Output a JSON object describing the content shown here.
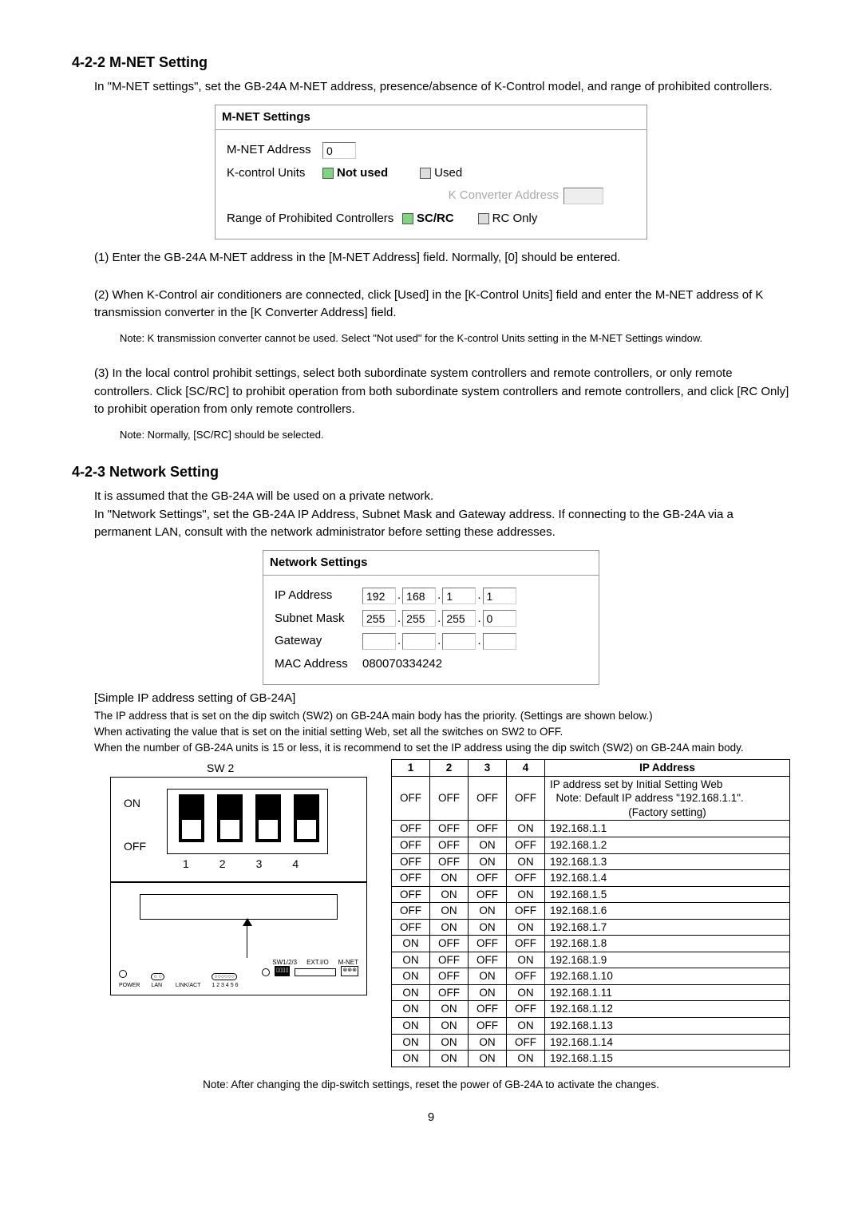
{
  "sec422": {
    "heading": "4-2-2 M-NET Setting",
    "intro": "In \"M-NET settings\", set the GB-24A M-NET address, presence/absence of K-Control model, and range of prohibited controllers.",
    "box": {
      "title": "M-NET Settings",
      "mnet_label": "M-NET Address",
      "mnet_value": "0",
      "kcontrol_label": "K-control Units",
      "notused": "Not used",
      "used": "Used",
      "kconv_label": "K Converter Address",
      "kconv_value": "",
      "range_label": "Range of Prohibited Controllers",
      "scrc": "SC/RC",
      "rconly": "RC Only"
    },
    "p1": "(1) Enter the GB-24A M-NET address in the [M-NET Address] field. Normally, [0] should be entered.",
    "p2": "(2) When K-Control air conditioners are connected, click [Used] in the [K-Control Units] field and enter the M-NET address of K transmission converter in the [K Converter Address] field.",
    "p2note": "Note: K transmission converter cannot be used. Select \"Not used\" for the K-control Units setting in the M-NET Settings window.",
    "p3": "(3) In the local control prohibit settings, select both subordinate system controllers and remote controllers, or only remote controllers. Click [SC/RC] to prohibit operation from both subordinate system controllers and remote controllers, and click [RC Only] to prohibit operation from only remote controllers.",
    "p3note": "Note: Normally, [SC/RC] should be selected."
  },
  "sec423": {
    "heading": "4-2-3 Network Setting",
    "intro1": "It is assumed that the GB-24A will be used on a private network.",
    "intro2": "In \"Network Settings\", set the GB-24A IP Address, Subnet Mask and Gateway address. If connecting to the GB-24A via a permanent LAN, consult with the network administrator before setting these addresses.",
    "box": {
      "title": "Network Settings",
      "ip_label": "IP Address",
      "ip": [
        "192",
        "168",
        "1",
        "1"
      ],
      "sm_label": "Subnet Mask",
      "sm": [
        "255",
        "255",
        "255",
        "0"
      ],
      "gw_label": "Gateway",
      "gw": [
        "",
        "",
        "",
        ""
      ],
      "mac_label": "MAC Address",
      "mac_value": "080070334242"
    },
    "simple_heading": "[Simple IP address setting of GB-24A]",
    "s1": "The IP address that is set on the dip switch (SW2) on GB-24A main body has the priority. (Settings are shown below.)",
    "s2": "When activating the value that is set on the initial setting Web, set all the switches on SW2 to OFF.",
    "s3": "When the number of GB-24A units is 15 or less, it is recommend to set the IP address using the dip switch (SW2) on GB-24A main body.",
    "dip": {
      "sw2": "SW 2",
      "on": "ON",
      "off": "OFF",
      "nums": [
        "1",
        "2",
        "3",
        "4"
      ]
    },
    "module_labels": {
      "sw": "SW1/2/3",
      "ext": "EXT.I/O",
      "mnet": "M-NET",
      "power": "POWER",
      "lan": "LAN",
      "link": "LINK/ACT",
      "n16": "1 2 3 4 5 6"
    },
    "ip_table": {
      "head": [
        "1",
        "2",
        "3",
        "4",
        "IP Address"
      ],
      "row0_addr_l1": "IP address set by Initial Setting Web",
      "row0_addr_l2": "Note: Default IP address \"192.168.1.1\".",
      "row0_addr_l3": "(Factory setting)",
      "rows": [
        [
          "OFF",
          "OFF",
          "OFF",
          "OFF",
          ""
        ],
        [
          "OFF",
          "OFF",
          "OFF",
          "ON",
          "192.168.1.1"
        ],
        [
          "OFF",
          "OFF",
          "ON",
          "OFF",
          "192.168.1.2"
        ],
        [
          "OFF",
          "OFF",
          "ON",
          "ON",
          "192.168.1.3"
        ],
        [
          "OFF",
          "ON",
          "OFF",
          "OFF",
          "192.168.1.4"
        ],
        [
          "OFF",
          "ON",
          "OFF",
          "ON",
          "192.168.1.5"
        ],
        [
          "OFF",
          "ON",
          "ON",
          "OFF",
          "192.168.1.6"
        ],
        [
          "OFF",
          "ON",
          "ON",
          "ON",
          "192.168.1.7"
        ],
        [
          "ON",
          "OFF",
          "OFF",
          "OFF",
          "192.168.1.8"
        ],
        [
          "ON",
          "OFF",
          "OFF",
          "ON",
          "192.168.1.9"
        ],
        [
          "ON",
          "OFF",
          "ON",
          "OFF",
          "192.168.1.10"
        ],
        [
          "ON",
          "OFF",
          "ON",
          "ON",
          "192.168.1.11"
        ],
        [
          "ON",
          "ON",
          "OFF",
          "OFF",
          "192.168.1.12"
        ],
        [
          "ON",
          "ON",
          "OFF",
          "ON",
          "192.168.1.13"
        ],
        [
          "ON",
          "ON",
          "ON",
          "OFF",
          "192.168.1.14"
        ],
        [
          "ON",
          "ON",
          "ON",
          "ON",
          "192.168.1.15"
        ]
      ]
    },
    "final_note": "Note: After changing the dip-switch settings, reset the power of GB-24A to activate the changes."
  },
  "page_number": "9"
}
